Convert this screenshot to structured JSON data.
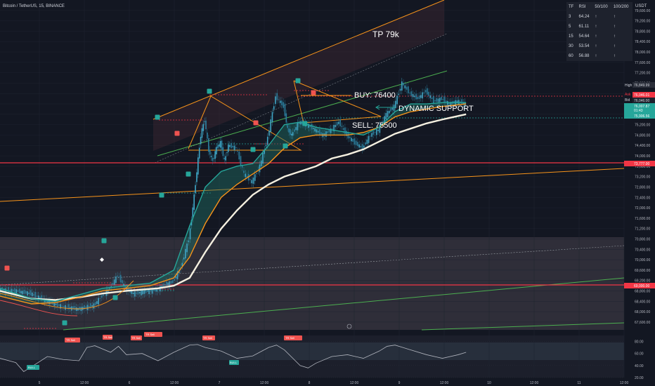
{
  "header": {
    "title": "Bitcoin / TetherUS, 15, BINANCE"
  },
  "axis": {
    "currency": "USDT"
  },
  "colors": {
    "up": "#26a69a",
    "down": "#ef5350",
    "orange": "#f7931a",
    "green": "#4caf50",
    "white": "#f5f0e0",
    "red": "#f23645"
  },
  "rsi_table": {
    "headers": [
      "TF",
      "RSI",
      "50/100",
      "100/200"
    ],
    "rows": [
      {
        "tf": "3",
        "rsi": "64.24",
        "a": "↑",
        "b": "↑"
      },
      {
        "tf": "5",
        "rsi": "61.11",
        "a": "↑",
        "b": "↑"
      },
      {
        "tf": "15",
        "rsi": "54.64",
        "a": "↑",
        "b": "↑"
      },
      {
        "tf": "30",
        "rsi": "53.54",
        "a": "↑",
        "b": "↑"
      },
      {
        "tf": "60",
        "rsi": "56.88",
        "a": "↑",
        "b": "↑"
      }
    ]
  },
  "annotations": {
    "tp": "TP 79k",
    "buy": "BUY: 76400",
    "dynamic": "DYNAMIC SUPPORT",
    "sell": "SELL: 75500"
  },
  "price_labels": {
    "high_tag": "High",
    "high": "76,849.99",
    "ask_tag": "Ask",
    "ask": "76,046.01",
    "bid_tag": "Bid",
    "bid": "76,046.00",
    "last": "76,007.87",
    "countdown": "01:43",
    "green_level": "75,906.56",
    "red_level1": "73,777.00",
    "red_level2": "69,000.00"
  },
  "indicator_labels": {
    "tr_sell": "TR Sell",
    "bull": "BULL"
  },
  "chart_data": {
    "type": "candlestick",
    "symbol": "BTCUSDT",
    "timeframe": "15",
    "x_tick_labels": [
      "5",
      "12:00",
      "6",
      "12:00",
      "7",
      "12:00",
      "8",
      "12:00",
      "9",
      "12:00",
      "10",
      "12:00",
      "11",
      "12:00"
    ],
    "y_ticks": [
      67600,
      68000,
      68400,
      68800,
      69200,
      69600,
      70000,
      70400,
      70800,
      71200,
      71600,
      72000,
      72400,
      72800,
      73200,
      73600,
      74000,
      74400,
      74800,
      75200,
      75600,
      76000,
      76400,
      76800,
      77200,
      77600,
      78000,
      78400,
      78800,
      79200,
      79600
    ],
    "y_tick_labels": [
      "67,600.00",
      "68,000.00",
      "68,400.00",
      "68,800.00",
      "69,200.00",
      "69,600.00",
      "70,000.00",
      "70,400.00",
      "70,800.00",
      "71,200.00",
      "71,600.00",
      "72,000.00",
      "72,400.00",
      "72,800.00",
      "73,200.00",
      "73,600.00",
      "74,000.00",
      "74,400.00",
      "74,800.00",
      "75,200.00",
      "75,600.00",
      "76,000.00",
      "76,400.00",
      "76,800.00",
      "77,200.00",
      "77,600.00",
      "78,000.00",
      "78,400.00",
      "78,800.00",
      "79,200.00",
      "79,600.00"
    ],
    "ylim": [
      67300,
      80000
    ],
    "xlim": [
      0,
      158
    ],
    "price_path": [
      [
        0,
        68850
      ],
      [
        4,
        68800
      ],
      [
        8,
        68700
      ],
      [
        12,
        68400
      ],
      [
        16,
        68200
      ],
      [
        20,
        68100
      ],
      [
        24,
        68250
      ],
      [
        26,
        68600
      ],
      [
        28,
        68900
      ],
      [
        30,
        69400
      ],
      [
        32,
        68900
      ],
      [
        34,
        68700
      ],
      [
        36,
        68750
      ],
      [
        38,
        68800
      ],
      [
        40,
        68850
      ],
      [
        42,
        69050
      ],
      [
        44,
        69150
      ],
      [
        46,
        69700
      ],
      [
        48,
        70800
      ],
      [
        49,
        72000
      ],
      [
        50,
        73400
      ],
      [
        51,
        74800
      ],
      [
        52,
        75400
      ],
      [
        53,
        74200
      ],
      [
        54,
        73800
      ],
      [
        55,
        74300
      ],
      [
        56,
        74500
      ],
      [
        57,
        73800
      ],
      [
        58,
        74400
      ],
      [
        60,
        74300
      ],
      [
        62,
        73300
      ],
      [
        64,
        73000
      ],
      [
        66,
        73600
      ],
      [
        68,
        74700
      ],
      [
        70,
        76300
      ],
      [
        72,
        75900
      ],
      [
        73,
        75000
      ],
      [
        74,
        74800
      ],
      [
        76,
        75300
      ],
      [
        78,
        75200
      ],
      [
        80,
        75000
      ],
      [
        82,
        74800
      ],
      [
        84,
        75000
      ],
      [
        86,
        75300
      ],
      [
        88,
        74800
      ],
      [
        90,
        74500
      ],
      [
        92,
        74300
      ],
      [
        94,
        74800
      ],
      [
        96,
        75000
      ],
      [
        98,
        75600
      ],
      [
        100,
        75900
      ],
      [
        102,
        76800
      ],
      [
        104,
        76400
      ],
      [
        106,
        76200
      ],
      [
        108,
        76500
      ],
      [
        110,
        76100
      ],
      [
        112,
        76200
      ],
      [
        114,
        76000
      ],
      [
        116,
        76100
      ],
      [
        118,
        76007
      ]
    ],
    "series": [
      {
        "name": "",
        "color": "#f5f0e0",
        "values": [
          [
            0,
            68800
          ],
          [
            8,
            68500
          ],
          [
            14,
            68450
          ],
          [
            20,
            68550
          ],
          [
            26,
            68700
          ],
          [
            32,
            68800
          ],
          [
            40,
            68900
          ],
          [
            44,
            69000
          ],
          [
            48,
            69300
          ],
          [
            52,
            70300
          ],
          [
            56,
            71200
          ],
          [
            60,
            71900
          ],
          [
            64,
            72500
          ],
          [
            68,
            72900
          ],
          [
            72,
            73200
          ],
          [
            76,
            73400
          ],
          [
            80,
            73600
          ],
          [
            84,
            73900
          ],
          [
            88,
            74050
          ],
          [
            92,
            74250
          ],
          [
            96,
            74550
          ],
          [
            100,
            74850
          ],
          [
            104,
            75050
          ],
          [
            108,
            75250
          ],
          [
            112,
            75400
          ],
          [
            118,
            75600
          ]
        ]
      },
      {
        "name": "",
        "color": "#f7931a",
        "values": [
          [
            0,
            68600
          ],
          [
            8,
            68300
          ],
          [
            14,
            68350
          ],
          [
            20,
            68550
          ],
          [
            26,
            68800
          ],
          [
            32,
            68900
          ],
          [
            38,
            69000
          ],
          [
            44,
            69300
          ],
          [
            48,
            70100
          ],
          [
            52,
            71400
          ],
          [
            56,
            72400
          ],
          [
            60,
            72900
          ],
          [
            64,
            73300
          ],
          [
            68,
            73700
          ],
          [
            72,
            74300
          ],
          [
            76,
            74700
          ],
          [
            80,
            74800
          ],
          [
            84,
            74800
          ],
          [
            88,
            74800
          ],
          [
            92,
            74900
          ],
          [
            96,
            75100
          ],
          [
            100,
            75500
          ],
          [
            104,
            75700
          ],
          [
            108,
            75800
          ],
          [
            112,
            75900
          ],
          [
            118,
            76000
          ]
        ]
      },
      {
        "name": "",
        "color": "#26a69a",
        "values": [
          [
            0,
            68900
          ],
          [
            8,
            68500
          ],
          [
            14,
            68400
          ],
          [
            20,
            68650
          ],
          [
            26,
            68900
          ],
          [
            32,
            69000
          ],
          [
            38,
            69100
          ],
          [
            44,
            69600
          ],
          [
            48,
            71300
          ],
          [
            52,
            72800
          ],
          [
            56,
            73400
          ],
          [
            60,
            73600
          ],
          [
            64,
            73700
          ],
          [
            68,
            74400
          ],
          [
            72,
            75200
          ],
          [
            76,
            75300
          ],
          [
            80,
            75100
          ],
          [
            84,
            75000
          ],
          [
            88,
            74900
          ],
          [
            92,
            74800
          ],
          [
            96,
            75100
          ],
          [
            100,
            75700
          ],
          [
            104,
            76000
          ],
          [
            108,
            76000
          ],
          [
            112,
            76050
          ],
          [
            118,
            76050
          ]
        ]
      }
    ],
    "rsi": {
      "ylim": [
        20,
        90
      ],
      "ticks": [
        20,
        40,
        60,
        80
      ],
      "tick_labels": [
        "20.00",
        "40.00",
        "60.00",
        "80.00"
      ],
      "values": [
        [
          0,
          52
        ],
        [
          4,
          45
        ],
        [
          6,
          30
        ],
        [
          8,
          38
        ],
        [
          12,
          55
        ],
        [
          16,
          50
        ],
        [
          20,
          48
        ],
        [
          22,
          70
        ],
        [
          24,
          73
        ],
        [
          28,
          62
        ],
        [
          30,
          72
        ],
        [
          32,
          58
        ],
        [
          36,
          60
        ],
        [
          40,
          48
        ],
        [
          44,
          62
        ],
        [
          46,
          68
        ],
        [
          48,
          74
        ],
        [
          50,
          75
        ],
        [
          52,
          70
        ],
        [
          56,
          64
        ],
        [
          60,
          52
        ],
        [
          64,
          56
        ],
        [
          68,
          70
        ],
        [
          70,
          74
        ],
        [
          72,
          66
        ],
        [
          76,
          40
        ],
        [
          78,
          36
        ],
        [
          80,
          44
        ],
        [
          84,
          55
        ],
        [
          88,
          58
        ],
        [
          92,
          52
        ],
        [
          96,
          64
        ],
        [
          98,
          72
        ],
        [
          100,
          74
        ],
        [
          102,
          70
        ],
        [
          104,
          66
        ],
        [
          108,
          58
        ],
        [
          112,
          52
        ],
        [
          116,
          58
        ],
        [
          118,
          62
        ]
      ]
    }
  }
}
